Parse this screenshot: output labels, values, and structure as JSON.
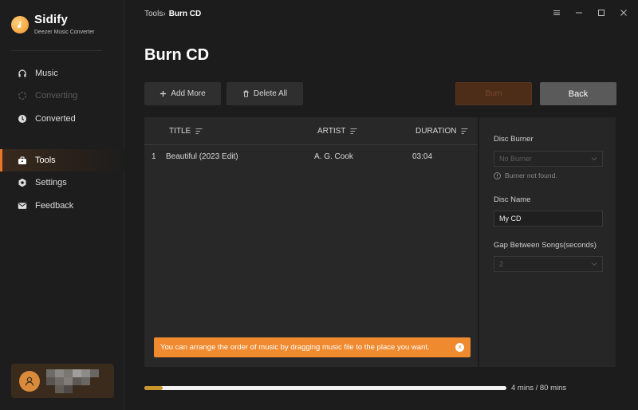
{
  "app": {
    "name": "Sidify",
    "subtitle": "Deezer Music Converter"
  },
  "sidebar": {
    "items": [
      {
        "label": "Music",
        "icon": "headphones-icon",
        "state": "normal"
      },
      {
        "label": "Converting",
        "icon": "converting-icon",
        "state": "disabled"
      },
      {
        "label": "Converted",
        "icon": "clock-icon",
        "state": "normal"
      },
      {
        "label": "Tools",
        "icon": "toolbox-icon",
        "state": "active"
      },
      {
        "label": "Settings",
        "icon": "gear-icon",
        "state": "normal"
      },
      {
        "label": "Feedback",
        "icon": "mail-icon",
        "state": "normal"
      }
    ]
  },
  "breadcrumb": {
    "parent": "Tools",
    "separator": "›",
    "current": "Burn CD"
  },
  "page": {
    "title": "Burn CD"
  },
  "toolbar": {
    "add_label": "Add More",
    "delete_label": "Delete All",
    "burn_label": "Burn",
    "back_label": "Back"
  },
  "table": {
    "columns": [
      "TITLE",
      "ARTIST",
      "DURATION"
    ],
    "rows": [
      {
        "index": "1",
        "title": "Beautiful (2023 Edit)",
        "artist": "A. G. Cook",
        "duration": "03:04"
      }
    ]
  },
  "tip": {
    "text": "You can arrange the order of music by dragging music file to the place you want."
  },
  "settings": {
    "disc_burner_label": "Disc Burner",
    "disc_burner_value": "No Burner",
    "burner_warning": "Burner not found.",
    "disc_name_label": "Disc Name",
    "disc_name_value": "My CD",
    "gap_label": "Gap Between Songs(seconds)",
    "gap_value": "2"
  },
  "progress": {
    "text": "4 mins / 80 mins",
    "fraction": 0.05
  },
  "colors": {
    "accent": "#f08a2e",
    "progress_fill": "#c9962d",
    "background": "#1c1c1c"
  }
}
